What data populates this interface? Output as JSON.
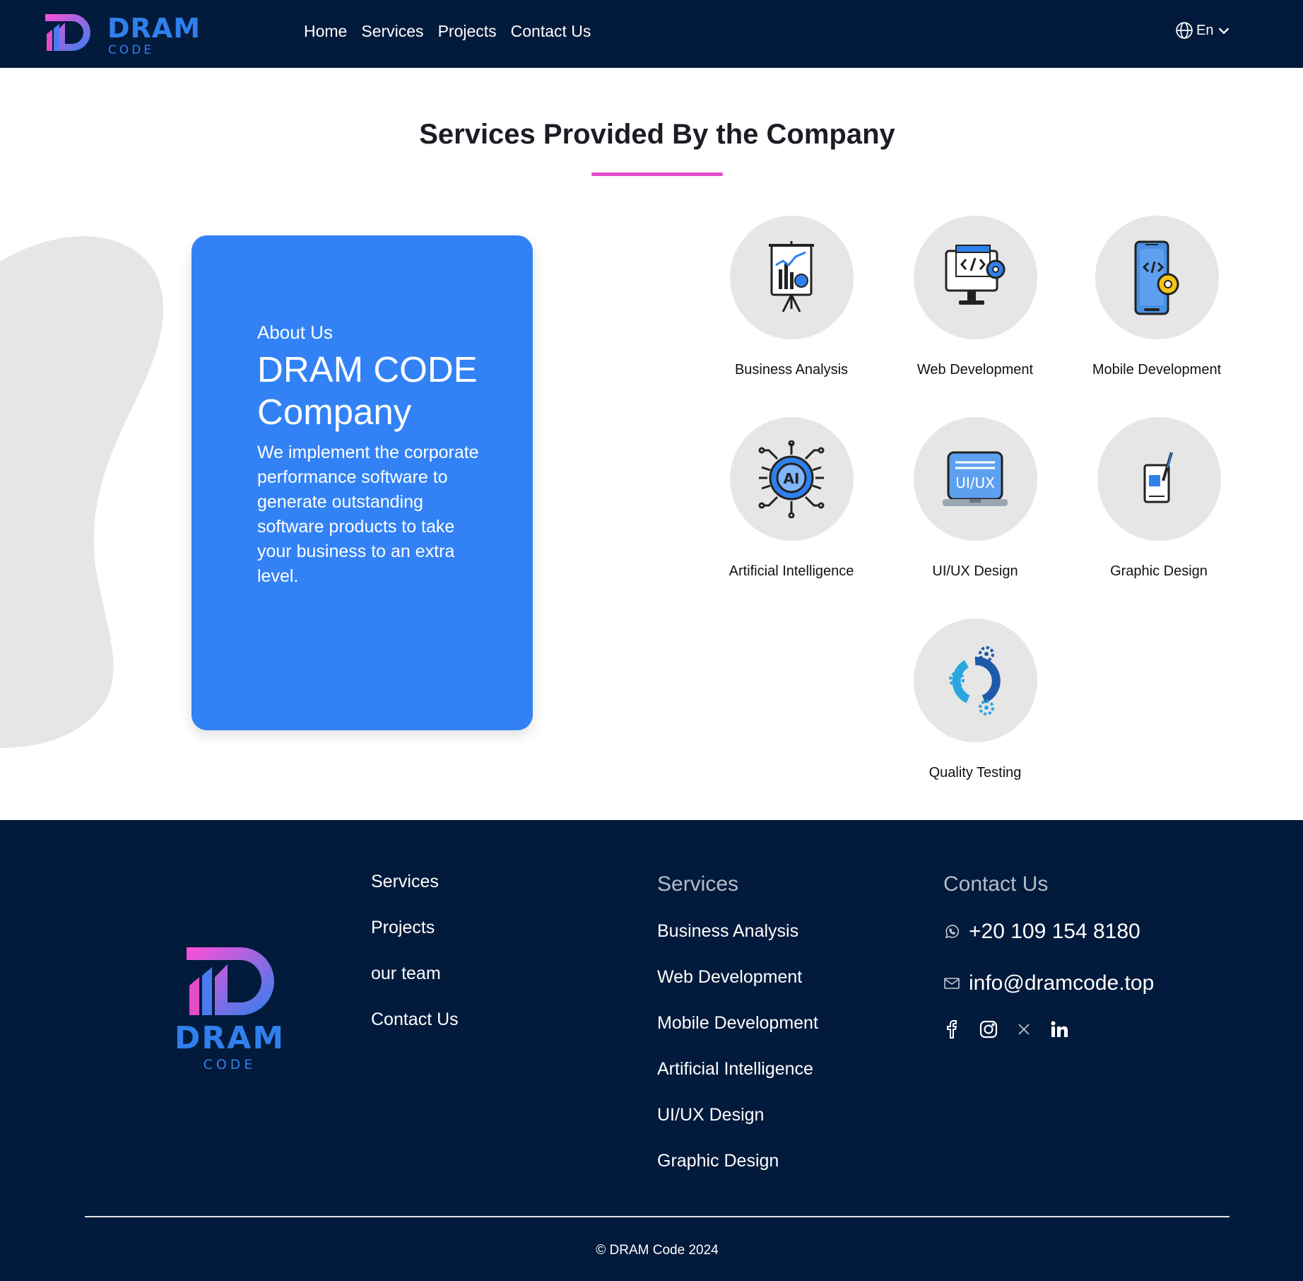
{
  "header": {
    "logo_word": "DRAM",
    "logo_sub": "CODE",
    "nav": [
      "Home",
      "Services",
      "Projects",
      "Contact Us"
    ],
    "language": "En"
  },
  "section": {
    "title": "Services Provided By the Company"
  },
  "about": {
    "label": "About Us",
    "heading": "DRAM CODE Company",
    "description": "We implement the corporate performance software to generate outstanding software products to take your business to an extra level."
  },
  "services": [
    {
      "name": "Business Analysis",
      "icon": "presentation-chart-icon"
    },
    {
      "name": "Web Development",
      "icon": "code-monitor-icon"
    },
    {
      "name": "Mobile Development",
      "icon": "mobile-code-icon"
    },
    {
      "name": "Artificial Intelligence",
      "icon": "ai-chip-icon"
    },
    {
      "name": "UI/UX Design",
      "icon": "uiux-laptop-icon"
    },
    {
      "name": "Graphic Design",
      "icon": "tablet-pen-icon"
    },
    {
      "name": "Quality Testing",
      "icon": "gears-cycle-icon"
    }
  ],
  "footer": {
    "logo_word": "DRAM",
    "logo_sub": "CODE",
    "links": [
      "Services",
      "Projects",
      "our team",
      "Contact Us"
    ],
    "services_title": "Services",
    "services_links": [
      "Business Analysis",
      "Web Development",
      "Mobile Development",
      "Artificial Intelligence",
      "UI/UX Design",
      "Graphic Design"
    ],
    "contact_title": "Contact Us",
    "phone": "+20 109 154 8180",
    "email": "info@dramcode.top",
    "socials": [
      "facebook-icon",
      "instagram-icon",
      "x-icon",
      "linkedin-icon"
    ],
    "copyright": "© DRAM Code 2024"
  },
  "colors": {
    "navy": "#021a3b",
    "accent_blue": "#2f80ed",
    "card_blue": "#3282f6",
    "accent_pink": "#e24cc7"
  }
}
